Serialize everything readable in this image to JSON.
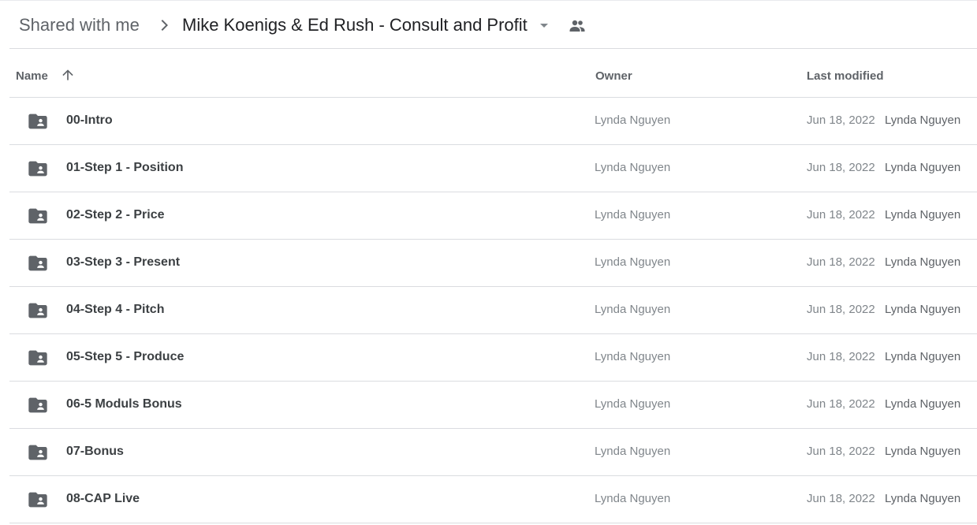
{
  "breadcrumb": {
    "root": "Shared with me",
    "current": "Mike Koenigs & Ed Rush - Consult and Profit"
  },
  "icons": {
    "separator": "chevron-right-icon",
    "caret": "arrow-drop-down-icon",
    "shared": "people-icon",
    "sort": "arrow-up-icon",
    "folder": "shared-folder-icon"
  },
  "columns": {
    "name": "Name",
    "owner": "Owner",
    "modified": "Last modified"
  },
  "files": [
    {
      "name": "00-Intro",
      "owner": "Lynda Nguyen",
      "modified": "Jun 18, 2022",
      "modified_by": "Lynda Nguyen"
    },
    {
      "name": "01-Step 1 - Position",
      "owner": "Lynda Nguyen",
      "modified": "Jun 18, 2022",
      "modified_by": "Lynda Nguyen"
    },
    {
      "name": "02-Step 2 - Price",
      "owner": "Lynda Nguyen",
      "modified": "Jun 18, 2022",
      "modified_by": "Lynda Nguyen"
    },
    {
      "name": "03-Step 3 - Present",
      "owner": "Lynda Nguyen",
      "modified": "Jun 18, 2022",
      "modified_by": "Lynda Nguyen"
    },
    {
      "name": "04-Step 4 - Pitch",
      "owner": "Lynda Nguyen",
      "modified": "Jun 18, 2022",
      "modified_by": "Lynda Nguyen"
    },
    {
      "name": "05-Step 5 - Produce",
      "owner": "Lynda Nguyen",
      "modified": "Jun 18, 2022",
      "modified_by": "Lynda Nguyen"
    },
    {
      "name": "06-5 Moduls Bonus",
      "owner": "Lynda Nguyen",
      "modified": "Jun 18, 2022",
      "modified_by": "Lynda Nguyen"
    },
    {
      "name": "07-Bonus",
      "owner": "Lynda Nguyen",
      "modified": "Jun 18, 2022",
      "modified_by": "Lynda Nguyen"
    },
    {
      "name": "08-CAP Live",
      "owner": "Lynda Nguyen",
      "modified": "Jun 18, 2022",
      "modified_by": "Lynda Nguyen"
    }
  ],
  "colors": {
    "icon": "#5f6368",
    "divider": "#dadce0",
    "text_primary": "#202124",
    "text_secondary": "#80868b"
  }
}
